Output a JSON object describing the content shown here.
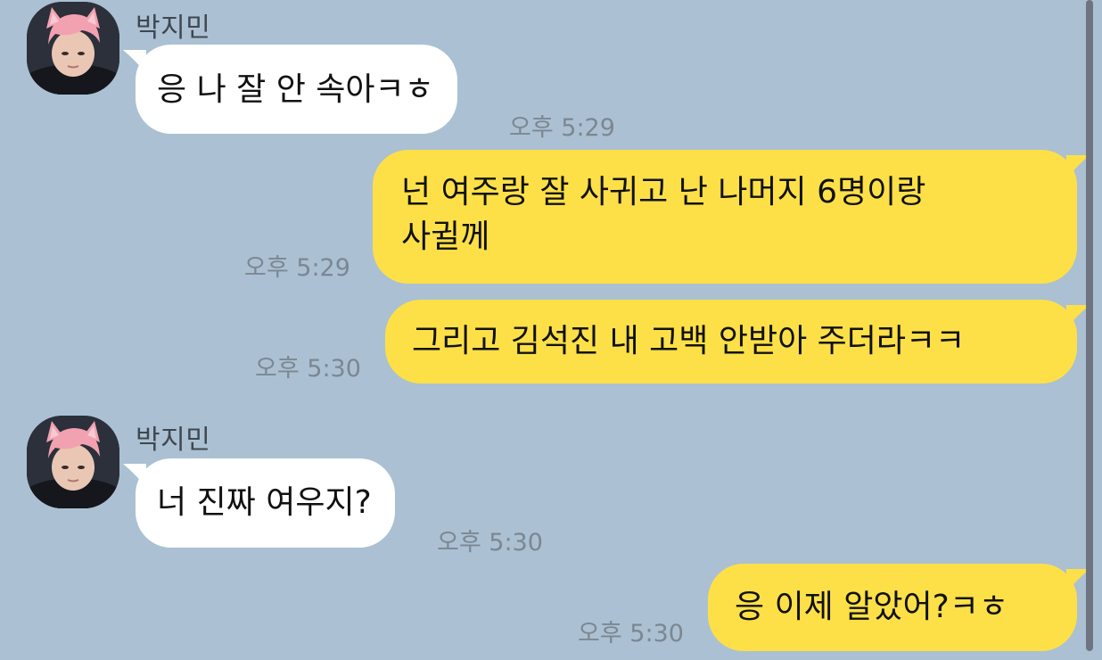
{
  "messages": [
    {
      "sender": "박지민",
      "text": "응 나 잘 안 속아ㅋㅎ",
      "time": "오후 5:29"
    },
    {
      "line1": "넌 여주랑 잘 사귀고 난 나머지 6명이랑",
      "line2": "사귈께",
      "time": "오후 5:29"
    },
    {
      "text": "그리고 김석진 내 고백 안받아 주더라ㅋㅋ",
      "time": "오후 5:30"
    },
    {
      "sender": "박지민",
      "text": "너 진짜 여우지?",
      "time": "오후 5:30"
    },
    {
      "text": "응 이제 알았어?ㅋㅎ",
      "time": "오후 5:30"
    }
  ],
  "colors": {
    "background": "#abc0d3",
    "incoming_bubble": "#ffffff",
    "outgoing_bubble": "#fde047",
    "time_text": "#7c8791",
    "sender_text": "#3f4750"
  }
}
